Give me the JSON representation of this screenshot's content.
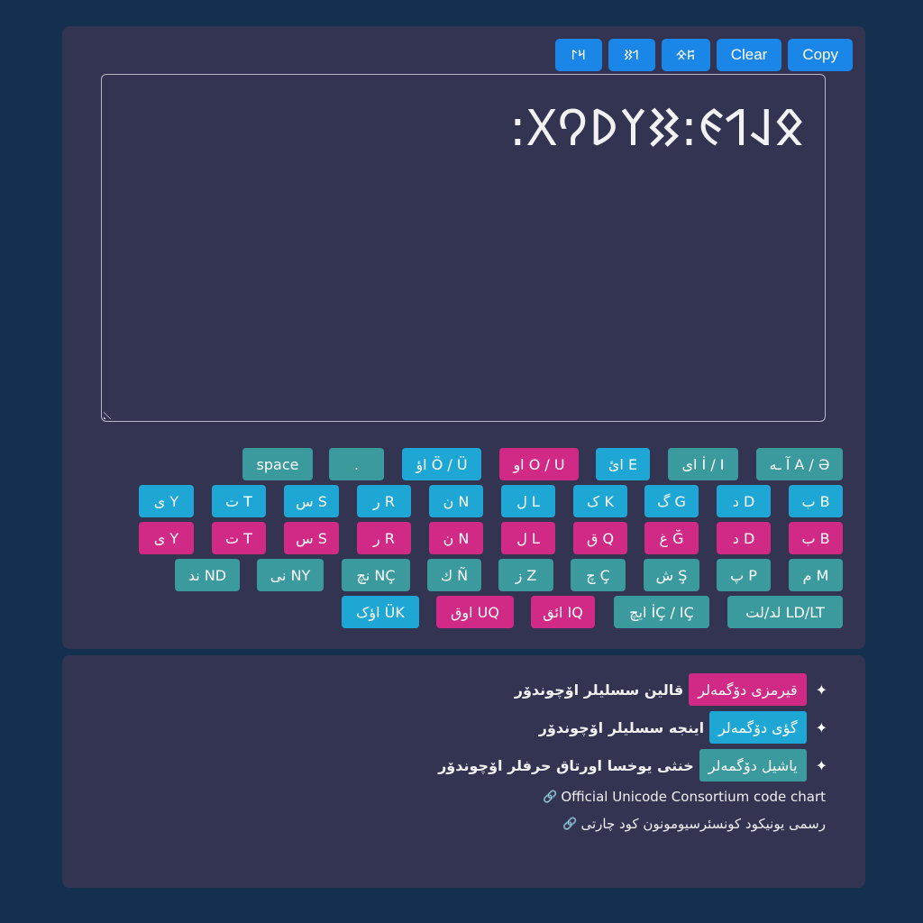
{
  "toolbar": {
    "buttons": [
      {
        "label": "𐰺𐰃",
        "kind": "script-1"
      },
      {
        "label": "𐰯𐰑",
        "kind": "script-2"
      },
      {
        "label": "𐰰𐰌",
        "kind": "script-3"
      },
      {
        "label": "Clear",
        "kind": "clear"
      },
      {
        "label": "Copy",
        "kind": "copy"
      }
    ]
  },
  "editor": {
    "text": ":𐰋𐰞𐰯𐰏:𐰑𐰠𐰖𐰘𐰓"
  },
  "keyboard": {
    "row1": [
      "آ ـه A / Ə",
      "ای İ / I",
      "ائ E",
      "او O / U",
      "اؤ Ö / Ü",
      ".",
      "space"
    ],
    "row2": [
      "ب B",
      "د D",
      "گ G",
      "ک K",
      "ل L",
      "ن N",
      "ر R",
      "س S",
      "ت T",
      "ی Y"
    ],
    "row3": [
      "ب B",
      "د D",
      "غ Ğ",
      "ق Q",
      "ل L",
      "ن N",
      "ر R",
      "س S",
      "ت T",
      "ی Y"
    ],
    "row4": [
      "م M",
      "پ P",
      "ش Ş",
      "چ Ç",
      "ز Z",
      "ك Ñ",
      "نچ NÇ",
      "نی NY",
      "ند ND"
    ],
    "row5": [
      "لد/لت LD/LT",
      "ایچ İÇ / IÇ",
      "ائق IQ",
      "اوق UQ",
      "اؤک ÜK"
    ]
  },
  "info": {
    "lines": [
      {
        "badge": "قیرمزی دۆگمه‌لر",
        "text": "قالین سسلیلر اۆچوندۆر",
        "color": "#d02a86"
      },
      {
        "badge": "گؤی دۆگمه‌لر",
        "text": "اینجه سسلیلر اۆچوندۆر",
        "color": "#1ea7d4"
      },
      {
        "badge": "یاشیل دۆگمه‌لر",
        "text": "خنثی یوخسا اورتاق حرفلر اۆچوندۆر",
        "color": "#3a9a9e"
      }
    ],
    "link_en": "Official Unicode Consortium code chart",
    "link_fa": "رسمی یونیکود کونسئرسیومونون کود چارتی"
  },
  "colors": {
    "background": "#14304f",
    "panel": "#333352",
    "teal": "#3a9a9e",
    "blue": "#1ea7d4",
    "pink": "#d02a86",
    "toolbar": "#1a86e8"
  }
}
